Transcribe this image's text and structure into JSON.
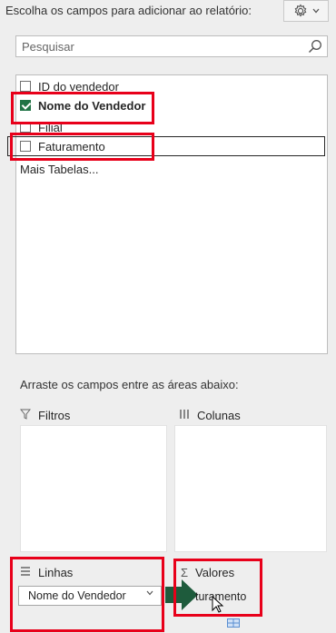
{
  "header": {
    "title": "Escolha os campos para adicionar ao relatório:",
    "gear_icon": "gear-icon",
    "dropdown_icon": "chevron-down-icon"
  },
  "search": {
    "placeholder": "Pesquisar",
    "icon": "search-icon"
  },
  "fields": [
    {
      "label": "ID do vendedor",
      "checked": false
    },
    {
      "label": "Nome do Vendedor",
      "checked": true
    },
    {
      "label": "Filial",
      "checked": false
    },
    {
      "label": "Faturamento",
      "checked": false
    }
  ],
  "more_tables": "Mais Tabelas...",
  "areas_label": "Arraste os campos entre as áreas abaixo:",
  "areas": {
    "filters": {
      "label": "Filtros",
      "icon": "filter-icon"
    },
    "columns": {
      "label": "Colunas",
      "icon": "columns-icon"
    },
    "rows": {
      "label": "Linhas",
      "icon": "rows-icon",
      "item": "Nome do Vendedor"
    },
    "values": {
      "label": "Valores",
      "icon": "sigma-icon",
      "item": "turamento"
    }
  },
  "colors": {
    "highlight": "#e8001a",
    "excel_green": "#217346",
    "arrow_green": "#1e5b3c"
  }
}
